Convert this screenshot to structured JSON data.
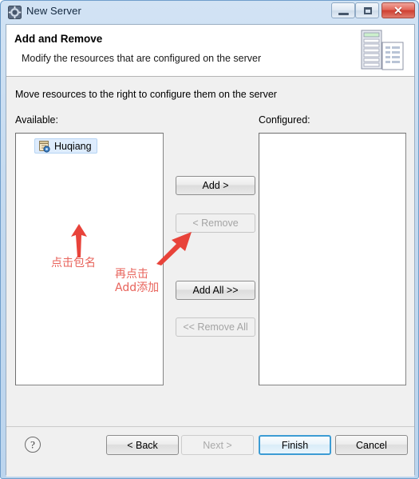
{
  "window": {
    "title": "New Server",
    "icon": "server-gear-icon",
    "controls": {
      "minimize": "minimize-icon",
      "maximize": "maximize-icon",
      "close": "✕"
    }
  },
  "header": {
    "title": "Add and Remove",
    "subtitle": "Modify the resources that are configured on the server",
    "icon": "server-and-document-icon"
  },
  "main": {
    "instruction": "Move resources to the right to configure them on the server",
    "available": {
      "label": "Available:",
      "items": [
        {
          "label": "Huqiang",
          "icon": "java-project-icon",
          "selected": true
        }
      ]
    },
    "configured": {
      "label": "Configured:",
      "items": []
    },
    "transfer_buttons": [
      {
        "label": "Add >",
        "enabled": true
      },
      {
        "label": "< Remove",
        "enabled": false
      },
      {
        "label": "Add All >>",
        "enabled": true
      },
      {
        "label": "<< Remove All",
        "enabled": false
      }
    ],
    "annotations": [
      {
        "text": "点击包名",
        "color": "#e8635b"
      },
      {
        "line1": "再点击",
        "line2": "Add添加",
        "color": "#e8635b"
      }
    ]
  },
  "footer": {
    "help": "help-icon",
    "buttons": [
      {
        "label": "< Back",
        "enabled": true,
        "default": false
      },
      {
        "label": "Next >",
        "enabled": false,
        "default": false
      },
      {
        "label": "Finish",
        "enabled": true,
        "default": true
      },
      {
        "label": "Cancel",
        "enabled": true,
        "default": false
      }
    ]
  },
  "colors": {
    "annotation": "#e8635b",
    "selection": "#deecfd",
    "default_button_border": "#3c9cd4"
  }
}
